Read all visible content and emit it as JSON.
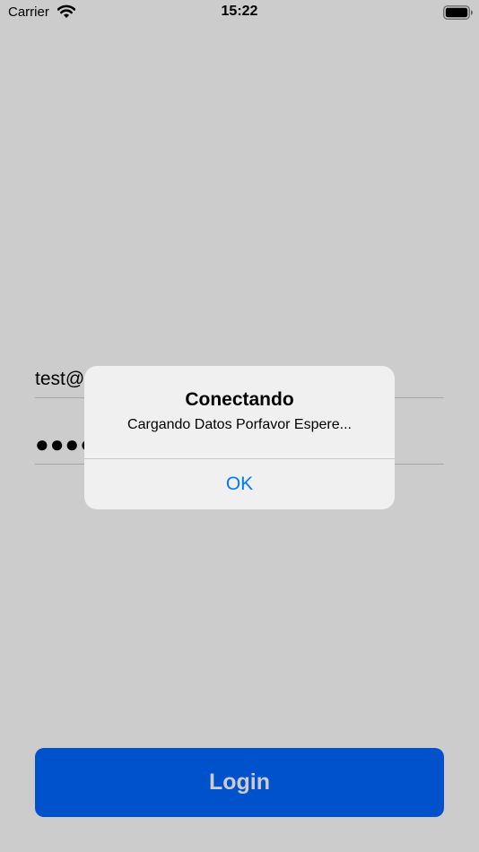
{
  "status_bar": {
    "carrier": "Carrier",
    "time": "15:22"
  },
  "form": {
    "email_value": "test@",
    "password_value": "●●●●"
  },
  "login_button": {
    "label": "Login"
  },
  "alert": {
    "title": "Conectando",
    "message": "Cargando Datos Porfavor Espere...",
    "ok_label": "OK"
  },
  "colors": {
    "accent": "#0066ff",
    "alert_action": "#007aff"
  },
  "icons": {
    "wifi": "wifi-icon",
    "battery": "battery-icon"
  }
}
